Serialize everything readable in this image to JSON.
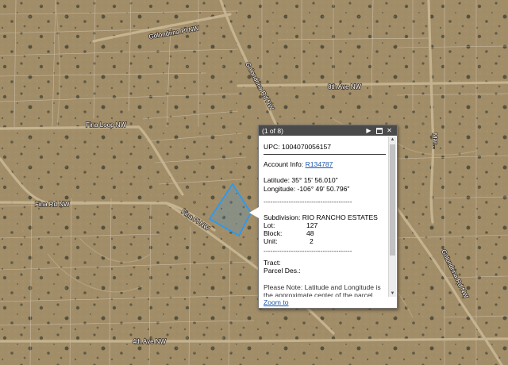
{
  "map": {
    "road_labels": [
      "Golondrina Pl NW",
      "Golondrina Rd NW",
      "8th Ave NW",
      "Fina Loop NW",
      "Fina Rd NW",
      "Fina Pl NW",
      "4th Ave NW",
      "Golondrina Rd NW",
      "Mar..."
    ],
    "parcel_outline_color": "#1f9bff",
    "road_color": "#c9b894"
  },
  "popup": {
    "title": "(1 of 8)",
    "next_icon": "play-right-icon",
    "maximize_icon": "maximize-icon",
    "close_icon": "close-icon",
    "upc_label": "UPC:",
    "upc_value": "1004070056157",
    "account_label": "Account Info:",
    "account_link": "R134787",
    "latitude": "Latitude: 35° 15' 56.010\"",
    "longitude": "Longitude: -106° 49' 50.796\"",
    "separator": "---------------------------------------",
    "subdivision": "Subdivision: RIO RANCHO ESTATES",
    "lot_label": "Lot:",
    "lot_value": "127",
    "block_label": "Block:",
    "block_value": "48",
    "unit_label": "Unit:",
    "unit_value": "2",
    "tract": "Tract:",
    "parcel_des": "Parcel Des.:",
    "note": "Please Note: Latitude and Longitude is the approximate center of the parcel shown.",
    "zoom_link": "Zoom to"
  }
}
